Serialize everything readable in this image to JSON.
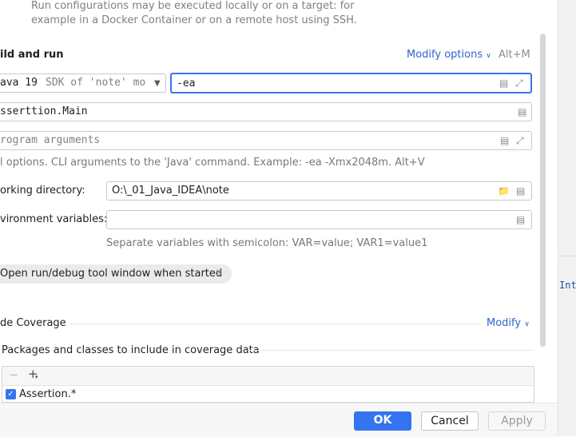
{
  "description": {
    "line1": "Run configurations may be executed locally or on a target: for",
    "line2": "example in a Docker Container or on a remote host using SSH."
  },
  "build_run": {
    "title": "ild and run",
    "modify_options": "Modify options",
    "shortcut": "Alt+M",
    "jdk_java": "ava 19",
    "jdk_hint": "SDK of 'note' mo",
    "vm_options_value": "-ea",
    "main_class": "sserttion.Main",
    "program_args_placeholder": "rogram arguments",
    "vm_hint": "l options. CLI arguments to the 'Java' command. Example: -ea -Xmx2048m. Alt+V"
  },
  "working_dir": {
    "label": "orking directory:",
    "value": "O:\\_01_Java_IDEA\\note"
  },
  "env_vars": {
    "label": "vironment variables:",
    "value": "",
    "hint": "Separate variables with semicolon: VAR=value; VAR1=value1"
  },
  "tag": {
    "label": "Open run/debug tool window when started"
  },
  "coverage": {
    "title": "de Coverage",
    "modify": "Modify",
    "packages_label": "Packages and classes to include in coverage data",
    "item": "Assertion.*"
  },
  "background_editor": {
    "text": "Int"
  },
  "footer": {
    "ok": "OK",
    "cancel": "Cancel",
    "apply": "Apply"
  },
  "colors": {
    "accent": "#3574f0",
    "link": "#2f64cf"
  },
  "icons": [
    "chevron-down-icon",
    "list-icon",
    "expand-icon",
    "folder-icon",
    "close-icon",
    "remove-icon",
    "add-icon",
    "checkbox-icon"
  ]
}
